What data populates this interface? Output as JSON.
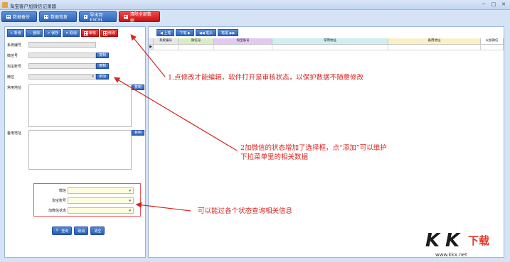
{
  "window": {
    "title": "淘宝客户加微信记录器",
    "controls": [
      "─",
      "□",
      "✕"
    ]
  },
  "toolbar": [
    {
      "label": "数据备份",
      "style": "blue"
    },
    {
      "label": "数据恢复",
      "style": "blue"
    },
    {
      "label": "导出到EXCEL",
      "style": "blue"
    },
    {
      "label": "清除全部数据",
      "style": "red"
    }
  ],
  "form_bar": [
    {
      "label": "+ 新增",
      "style": "blue"
    },
    {
      "label": "— 删除",
      "style": "blue"
    },
    {
      "label": "✔ 保存",
      "style": "blue"
    },
    {
      "label": "✕ 取消",
      "style": "blue"
    },
    {
      "label": "审核",
      "style": "red"
    },
    {
      "label": "修改",
      "style": "red"
    }
  ],
  "form": {
    "system_id_label": "系统编号",
    "wechat_label": "微信号",
    "taobao_label": "淘宝账号",
    "wechat_status_label": "微信",
    "copy_label": "复制",
    "add_label": "添加",
    "common_addr_label": "常用地址",
    "backup_addr_label": "备用地址"
  },
  "query": {
    "rows": [
      {
        "label": "微信"
      },
      {
        "label": "淘宝账号"
      },
      {
        "label": "加微信状态"
      }
    ],
    "buttons": [
      "查询",
      "取消",
      "清空"
    ]
  },
  "nav": [
    "◀ 上笔",
    "下笔 ▶",
    "◀◀ 笔头",
    "笔尾 ▶▶"
  ],
  "grid": {
    "columns": [
      {
        "label": "系统编号",
        "color": "#e7e7e7"
      },
      {
        "label": "微信号",
        "color": "#d9ecc4"
      },
      {
        "label": "淘宝账号",
        "color": "#e3c8f0"
      },
      {
        "label": "常用地址",
        "color": "#cdeff2"
      },
      {
        "label": "备用地址",
        "color": "#fbefc7"
      },
      {
        "label": "以加微信",
        "color": "#ffffff"
      }
    ]
  },
  "notes": {
    "note1": "1.点修改才能编辑，软件打开是审核状态，以保护数据不随意修改",
    "note2_line1": "2加微信的状态增加了选择框，点“添加”可以维护",
    "note2_line2": "下拉菜单里的相关数据",
    "note3": "可以能过各个状态查询相关信息"
  },
  "watermark": {
    "k1": "K",
    "k2": "K",
    "dl": "下载",
    "url": "www.kkx.net"
  },
  "colors": {
    "annotation": "#d8231f",
    "primary_button": "#2e64b8",
    "danger_button": "#c81414"
  }
}
